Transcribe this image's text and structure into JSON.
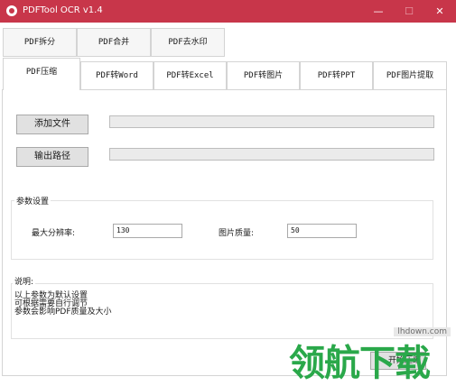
{
  "window": {
    "title": "PDFTool OCR v1.4",
    "controls": {
      "minimize": "—",
      "maximize": "☐",
      "close": "✕"
    }
  },
  "tabs_row1": [
    "PDF拆分",
    "PDF合并",
    "PDF去水印"
  ],
  "tabs_row2": [
    "PDF压缩",
    "PDF转Word",
    "PDF转Excel",
    "PDF转图片",
    "PDF转PPT",
    "PDF图片提取"
  ],
  "active_tab": "PDF压缩",
  "actions": {
    "add_file": "添加文件",
    "output_path": "输出路径",
    "start": "开始压缩"
  },
  "params": {
    "title": "参数设置",
    "max_resolution_label": "最大分辨率:",
    "max_resolution_value": "130",
    "image_quality_label": "图片质量:",
    "image_quality_value": "50"
  },
  "notes": {
    "title": "说明:",
    "lines": [
      "以上参数为默认设置",
      "可根据需要自行调节",
      "参数会影响PDF质量及大小"
    ]
  },
  "watermark": {
    "url": "lhdown.com",
    "text": "领航下载"
  }
}
